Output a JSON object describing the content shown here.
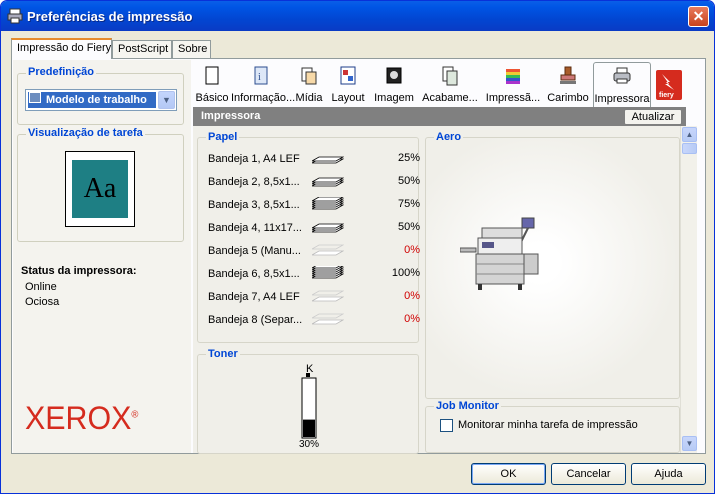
{
  "window": {
    "title": "Preferências de impressão",
    "close_glyph": "✕"
  },
  "tabs": [
    "Impressão do Fiery",
    "PostScript",
    "Sobre"
  ],
  "left": {
    "predefinicao_label": "Predefinição",
    "predefinicao_value": "Modelo de trabalho",
    "visualizacao_label": "Visualização de tarefa",
    "preview_text": "Aa",
    "status_title": "Status da impressora:",
    "status_lines": [
      "Online",
      "Ociosa"
    ],
    "brand": "XEROX",
    "brand_mark": "®"
  },
  "toolbar": {
    "items": [
      {
        "label": "Básico",
        "icon": "page-icon"
      },
      {
        "label": "Informação...",
        "icon": "info-icon"
      },
      {
        "label": "Mídia",
        "icon": "media-icon"
      },
      {
        "label": "Layout",
        "icon": "layout-icon"
      },
      {
        "label": "Imagem",
        "icon": "image-icon"
      },
      {
        "label": "Acabame...",
        "icon": "finishing-icon"
      },
      {
        "label": "Impressã...",
        "icon": "color-icon"
      },
      {
        "label": "Carimbo",
        "icon": "stamp-icon"
      },
      {
        "label": "Impressora",
        "icon": "printer-icon"
      }
    ],
    "fiery_text": "fiery"
  },
  "panel": {
    "header": "Impressora",
    "refresh_button": "Atualizar",
    "paper_label": "Papel",
    "trays": [
      {
        "name": "Bandeja 1, A4 LEF",
        "percent": "25%",
        "level": 0.25,
        "empty": false
      },
      {
        "name": "Bandeja 2, 8,5x1...",
        "percent": "50%",
        "level": 0.5,
        "empty": false
      },
      {
        "name": "Bandeja 3, 8,5x1...",
        "percent": "75%",
        "level": 0.75,
        "empty": false
      },
      {
        "name": "Bandeja 4, 11x17...",
        "percent": "50%",
        "level": 0.5,
        "empty": false
      },
      {
        "name": "Bandeja 5 (Manu...",
        "percent": "0%",
        "level": 0,
        "empty": true
      },
      {
        "name": "Bandeja 6, 8,5x1...",
        "percent": "100%",
        "level": 1,
        "empty": false
      },
      {
        "name": "Bandeja 7, A4 LEF",
        "percent": "0%",
        "level": 0,
        "empty": true
      },
      {
        "name": "Bandeja 8 (Separ...",
        "percent": "0%",
        "level": 0,
        "empty": true
      }
    ],
    "toner_label": "Toner",
    "toner_color": "K",
    "toner_percent": "30%",
    "toner_level": 0.3,
    "device_name": "Aero",
    "job_monitor_label": "Job Monitor",
    "job_monitor_checkbox": "Monitorar minha tarefa de impressão"
  },
  "buttons": {
    "ok": "OK",
    "cancel": "Cancelar",
    "help": "Ajuda"
  },
  "colors": {
    "accent": "#0046d5",
    "empty_percent": "#d00000",
    "brand": "#d52b1e",
    "titlebar": "#0055e5"
  }
}
